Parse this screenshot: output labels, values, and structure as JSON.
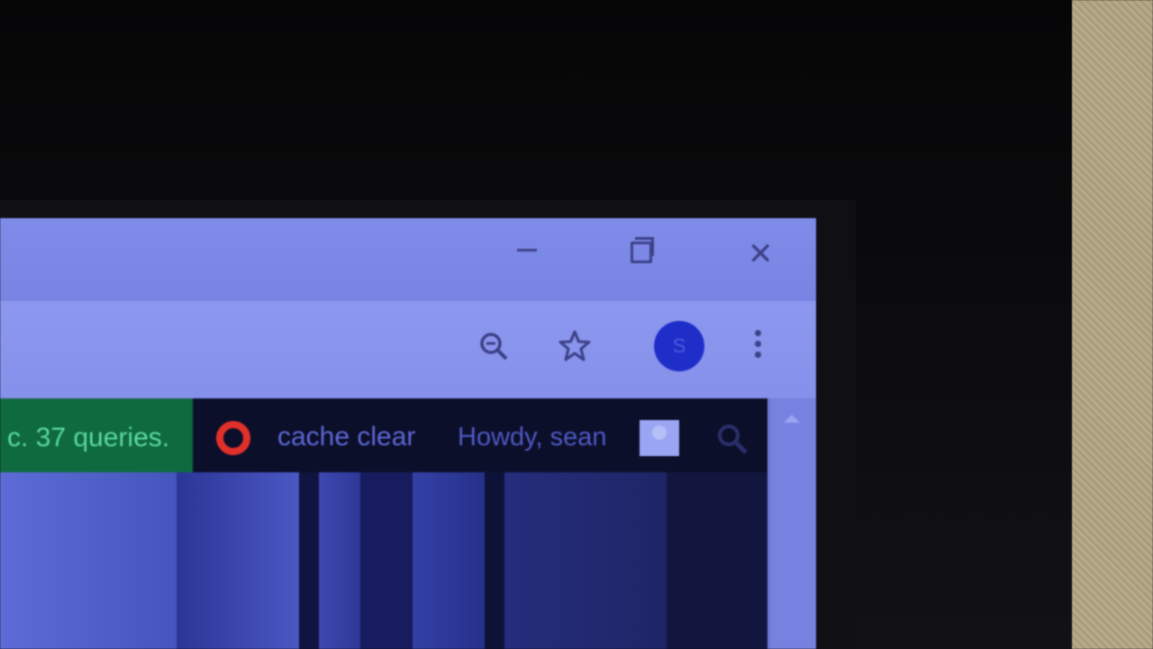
{
  "window": {
    "controls": {
      "minimize_icon": "minimize-icon",
      "maximize_icon": "restore-icon",
      "close_icon": "close-icon"
    }
  },
  "toolbar": {
    "zoom_icon": "zoom-icon",
    "bookmark_icon": "star-icon",
    "profile_initial": "S",
    "menu_icon": "more-vertical-icon"
  },
  "admin_bar": {
    "queries_text": "c. 37 queries.",
    "cache_label": "cache clear",
    "greeting": "Howdy, sean",
    "search_icon": "search-icon"
  },
  "colors": {
    "window": "#7b86e4",
    "toolbar": "#8c97ef",
    "admin_bar": "#0c0f2a",
    "queries_bg": "#0f6a3f",
    "queries_text": "#5ad7a0",
    "accent_red": "#e0302a",
    "profile_avatar": "#1f2ec9"
  }
}
